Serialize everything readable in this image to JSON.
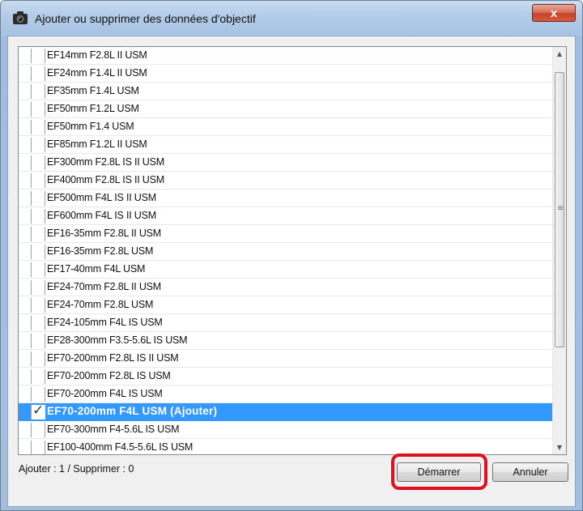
{
  "window": {
    "title": "Ajouter ou supprimer des données d'objectif",
    "close_label": "x"
  },
  "lens_list": {
    "items": [
      {
        "label": "EF14mm F2.8L II USM",
        "checked": false
      },
      {
        "label": "EF24mm F1.4L II USM",
        "checked": false
      },
      {
        "label": "EF35mm F1.4L USM",
        "checked": false
      },
      {
        "label": "EF50mm F1.2L USM",
        "checked": false
      },
      {
        "label": "EF50mm F1.4 USM",
        "checked": false
      },
      {
        "label": "EF85mm F1.2L II USM",
        "checked": false
      },
      {
        "label": "EF300mm F2.8L IS II USM",
        "checked": false
      },
      {
        "label": "EF400mm F2.8L IS II USM",
        "checked": false
      },
      {
        "label": "EF500mm F4L IS II USM",
        "checked": false
      },
      {
        "label": "EF600mm F4L IS II USM",
        "checked": false
      },
      {
        "label": "EF16-35mm F2.8L II USM",
        "checked": false
      },
      {
        "label": "EF16-35mm F2.8L USM",
        "checked": false
      },
      {
        "label": "EF17-40mm F4L USM",
        "checked": false
      },
      {
        "label": "EF24-70mm F2.8L II USM",
        "checked": false
      },
      {
        "label": "EF24-70mm F2.8L USM",
        "checked": false
      },
      {
        "label": "EF24-105mm F4L IS USM",
        "checked": false
      },
      {
        "label": "EF28-300mm F3.5-5.6L IS USM",
        "checked": false
      },
      {
        "label": "EF70-200mm F2.8L IS II USM",
        "checked": false
      },
      {
        "label": "EF70-200mm F2.8L IS USM",
        "checked": false
      },
      {
        "label": "EF70-200mm F4L IS USM",
        "checked": false
      },
      {
        "label": "EF70-200mm F4L USM (Ajouter)",
        "checked": true
      },
      {
        "label": "EF70-300mm F4-5.6L IS USM",
        "checked": false
      },
      {
        "label": "EF100-400mm F4.5-5.6L IS USM",
        "checked": false
      }
    ]
  },
  "status": {
    "text": "Ajouter : 1 / Supprimer : 0"
  },
  "buttons": {
    "start": "Démarrer",
    "cancel": "Annuler"
  },
  "icons": {
    "title": "camera-icon",
    "check": "checkmark-icon",
    "scroll_up": "arrow-up-icon",
    "scroll_down": "arrow-down-icon"
  },
  "colors": {
    "selection": "#3399ff",
    "highlight": "#e0101e"
  }
}
